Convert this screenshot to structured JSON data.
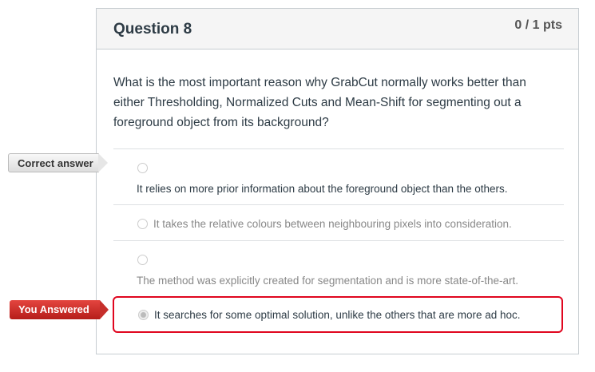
{
  "question": {
    "title": "Question 8",
    "points": "0 / 1 pts",
    "text": "What is the most important reason why GrabCut normally works better than either Thresholding, Normalized Cuts and Mean-Shift for segmenting out a foreground object from its background?"
  },
  "labels": {
    "correct": "Correct answer",
    "you_answered": "You Answered"
  },
  "answers": [
    {
      "text": "It relies on more prior information about the foreground object than the others.",
      "selected": false,
      "correct": true
    },
    {
      "text": "It takes the relative colours between neighbouring pixels into consideration.",
      "selected": false
    },
    {
      "text": "The method was explicitly created for segmentation and is more state-of-the-art.",
      "selected": false
    },
    {
      "text": "It searches for some optimal solution, unlike the others that are more ad hoc.",
      "selected": true
    }
  ],
  "colors": {
    "wrong": "#e0061f"
  }
}
